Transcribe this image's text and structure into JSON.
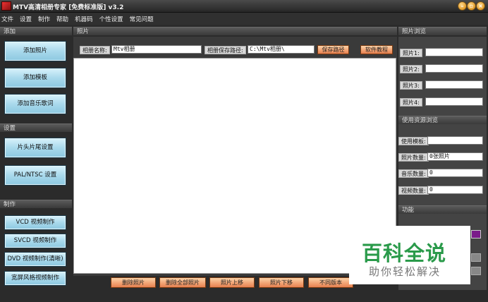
{
  "window": {
    "title": "MTV高清相册专家 [免费标准版] v3.2",
    "minimize_icon": "minimize-icon",
    "maximize_icon": "maximize-icon",
    "close_icon": "close-icon"
  },
  "menu": [
    "文件",
    "设置",
    "制作",
    "帮助",
    "机器码",
    "个性设置",
    "常见问题"
  ],
  "left": {
    "add_section": "添加",
    "add_photo": "添加照片",
    "add_template": "添加模板",
    "add_music": "添加音乐歌词",
    "settings_section": "设置",
    "title_settings": "片头片尾设置",
    "pal_ntsc": "PAL/NTSC 设置",
    "make_section": "制作",
    "vcd": "VCD 视频制作",
    "svcd": "SVCD 视频制作",
    "dvd": "DVD 视频制作(清晰)",
    "widescreen": "宽屏风格视频制作"
  },
  "main": {
    "section": "照片",
    "album_name_label": "相册名称:",
    "album_name_value": "Mtv相册",
    "save_path_label": "相册保存路径:",
    "save_path_value": "C:\\Mtv相册\\",
    "save_path_button": "保存路径",
    "tutorial_button": "软件教程",
    "delete_photo": "删除照片",
    "delete_all": "删除全部照片",
    "move_up": "照片上移",
    "move_down": "照片下移",
    "versions": "不同版本"
  },
  "right": {
    "preview_section": "照片浏览",
    "photo_labels": [
      "照片1:",
      "照片2:",
      "照片3:",
      "照片4:"
    ],
    "resource_section": "使用资源浏览",
    "template_label": "使用模板:",
    "template_value": "",
    "photo_count_label": "照片数量:",
    "photo_count_value": "0张照片",
    "music_count_label": "音乐数量:",
    "music_count_value": "0",
    "video_count_label": "视频数量:",
    "video_count_value": "0",
    "function_section": "功能"
  },
  "watermark": {
    "main": "百科全说",
    "sub": "助你轻松解决"
  },
  "colors": {
    "accent_green": "#2a9a4a",
    "button_blue": "#a9d9ec",
    "button_orange": "#f2a070"
  }
}
